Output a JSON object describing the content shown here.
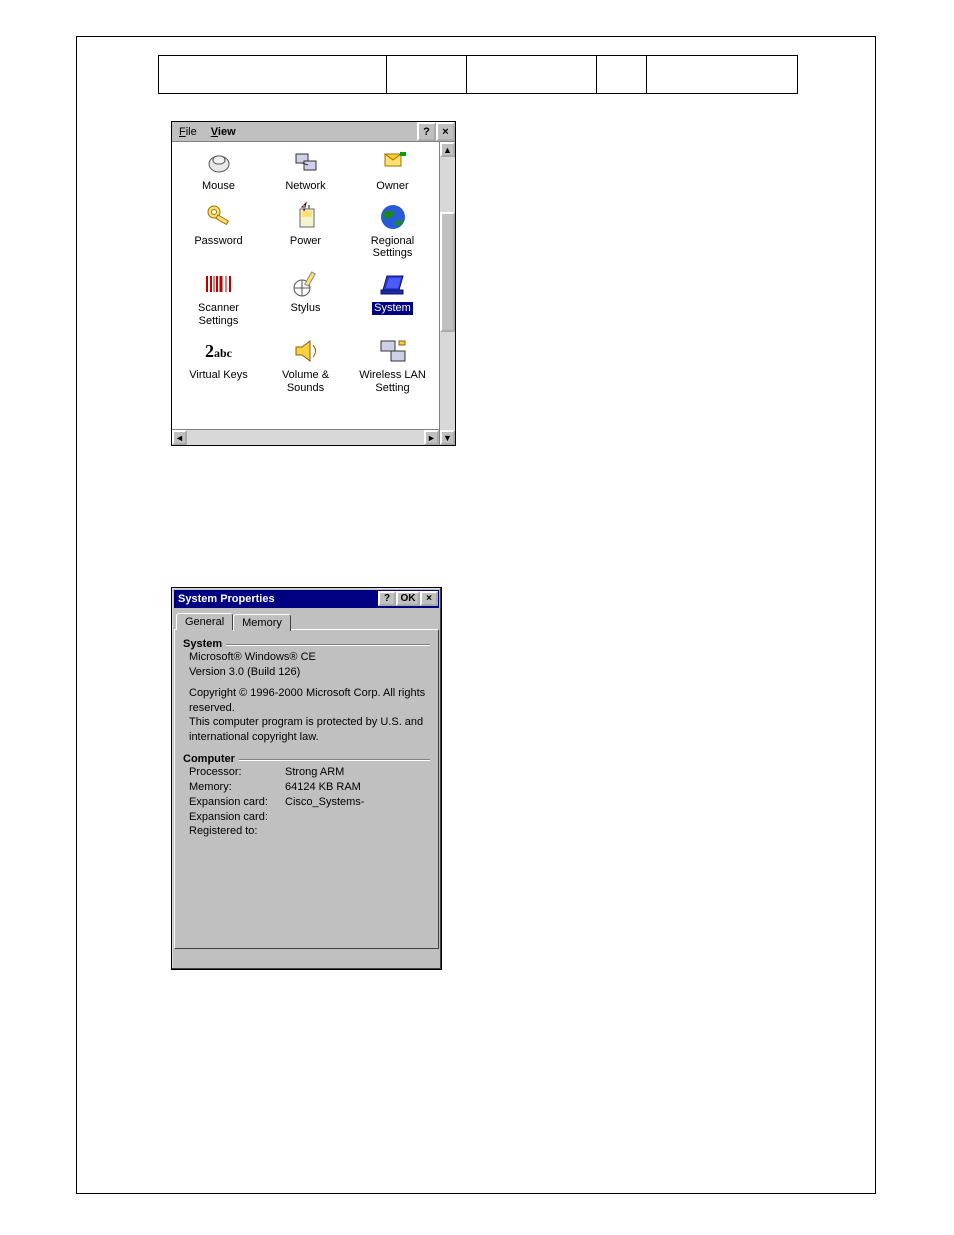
{
  "control_panel": {
    "menu": {
      "file": "File",
      "view": "View"
    },
    "help_btn": "?",
    "close_btn": "×",
    "items": [
      {
        "label": "Mouse"
      },
      {
        "label": "Network"
      },
      {
        "label": "Owner"
      },
      {
        "label": "Password"
      },
      {
        "label": "Power"
      },
      {
        "label": "Regional\nSettings"
      },
      {
        "label": "Scanner\nSettings"
      },
      {
        "label": "Stylus"
      },
      {
        "label": "System",
        "selected": true
      },
      {
        "label": "Virtual Keys"
      },
      {
        "label": "Volume &\nSounds"
      },
      {
        "label": "Wireless LAN\nSetting"
      }
    ],
    "scroll_up": "▲",
    "scroll_down": "▼",
    "scroll_left": "◄",
    "scroll_right": "►"
  },
  "system_properties": {
    "title": "System Properties",
    "help_btn": "?",
    "ok_btn": "OK",
    "close_btn": "×",
    "tabs": {
      "general": "General",
      "memory": "Memory"
    },
    "system_group": {
      "label": "System",
      "line1": "Microsoft® Windows® CE",
      "line2": "Version 3.0 (Build 126)",
      "copyright1": "Copyright © 1996-2000 Microsoft Corp. All rights reserved.",
      "copyright2": "This computer program is protected by U.S. and international copyright law."
    },
    "computer_group": {
      "label": "Computer",
      "rows": [
        {
          "k": "Processor:",
          "v": "Strong ARM"
        },
        {
          "k": "Memory:",
          "v": "64124 KB  RAM"
        },
        {
          "k": "Expansion card:",
          "v": "Cisco_Systems-"
        },
        {
          "k": "Expansion card:",
          "v": ""
        },
        {
          "k": "Registered to:",
          "v": ""
        }
      ]
    }
  }
}
